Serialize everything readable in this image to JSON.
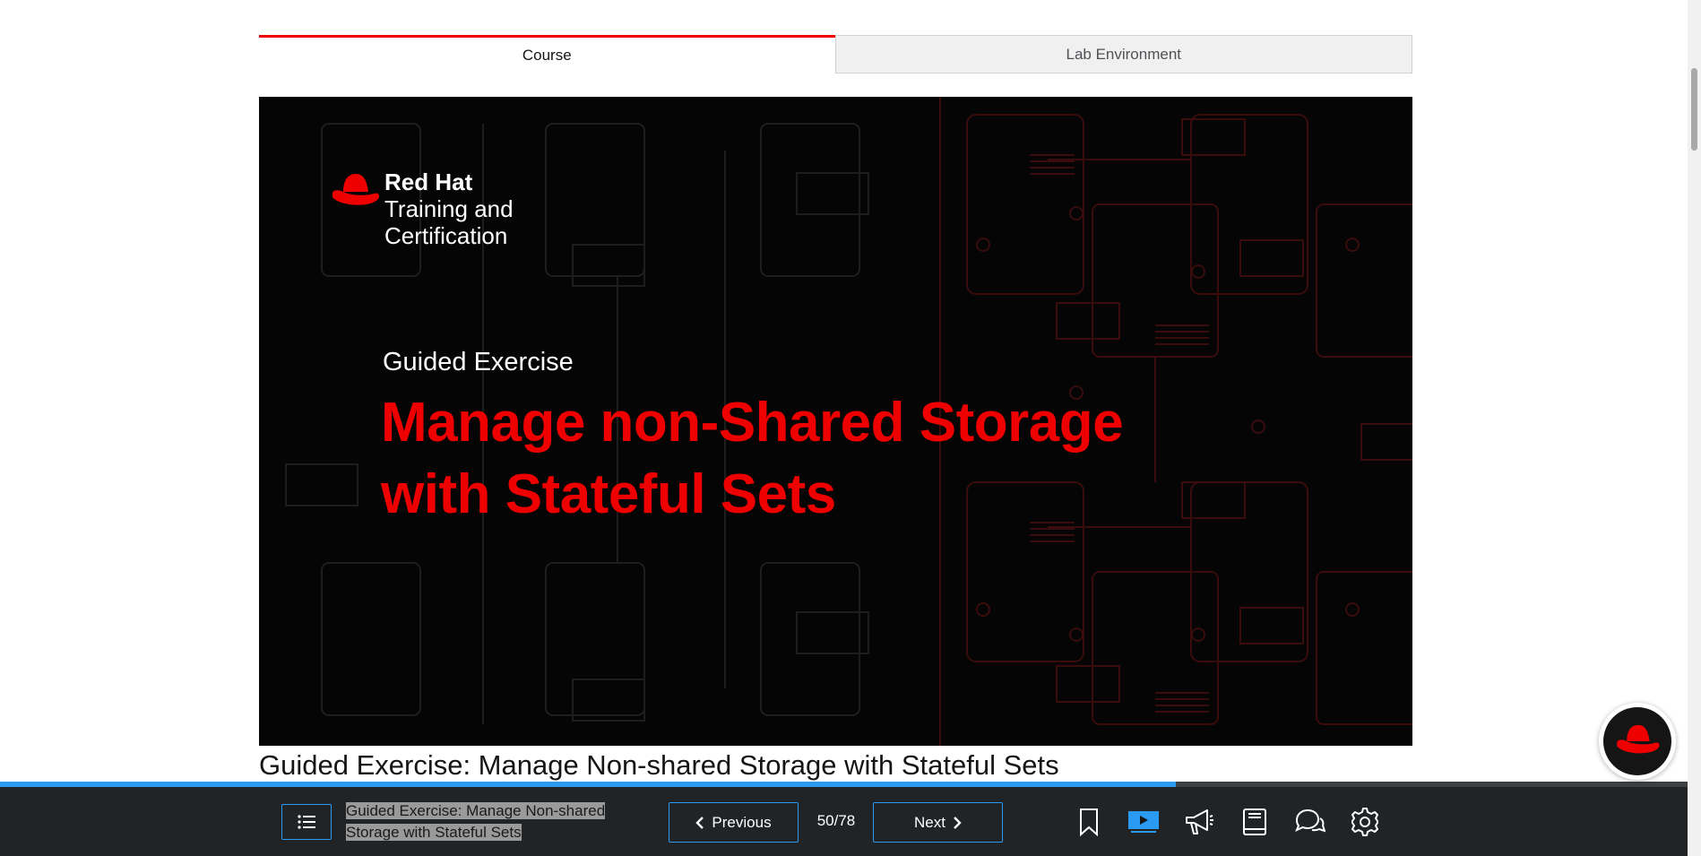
{
  "tabs": [
    {
      "label": "Course",
      "active": true
    },
    {
      "label": "Lab Environment",
      "active": false
    }
  ],
  "banner": {
    "brand_name": "Red Hat",
    "brand_line1": "Training and",
    "brand_line2": "Certification",
    "eyebrow": "Guided Exercise",
    "headline_line1": "Manage non-Shared Storage",
    "headline_line2": "with Stateful Sets"
  },
  "page_heading": "Guided Exercise: Manage Non-shared Storage with Stateful Sets",
  "progress": {
    "fraction": 0.697
  },
  "toolbar": {
    "title_line1": "Guided Exercise: Manage Non-shared",
    "title_line2": "Storage with Stateful Sets",
    "previous_label": "Previous",
    "next_label": "Next",
    "counter": "50/78",
    "icons": [
      "list-icon",
      "bookmark-icon",
      "video-icon",
      "megaphone-icon",
      "book-icon",
      "chat-icon",
      "gear-icon"
    ]
  },
  "colors": {
    "accent": "#ee0000",
    "toolbar_bg": "#212427",
    "link_blue": "#2b9af3"
  }
}
